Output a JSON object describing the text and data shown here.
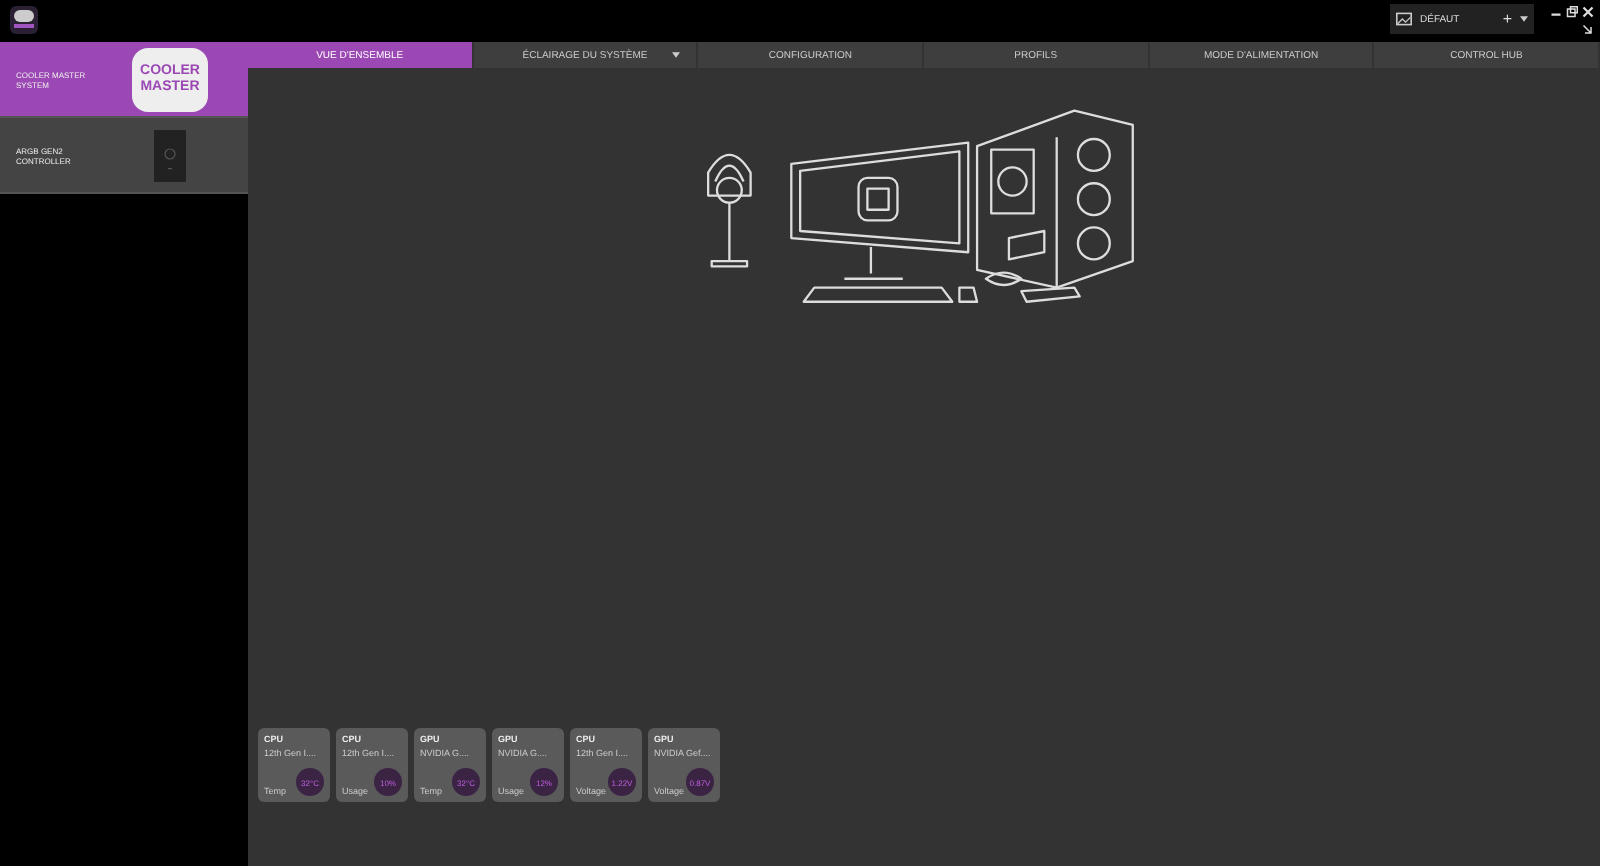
{
  "profile": {
    "name": "DÉFAUT",
    "add": "+"
  },
  "devices": [
    {
      "name": "COOLER MASTER SYSTEM",
      "selected": true,
      "kind": "logo",
      "logo_lines": [
        "COOLER",
        "MASTER"
      ]
    },
    {
      "name": "ARGB GEN2 CONTROLLER",
      "selected": false,
      "kind": "controller"
    }
  ],
  "tabs": [
    {
      "label": "VUE D'ENSEMBLE",
      "selected": true,
      "dropdown": false
    },
    {
      "label": "ÉCLAIRAGE DU SYSTÈME",
      "selected": false,
      "dropdown": true
    },
    {
      "label": "CONFIGURATION",
      "selected": false,
      "dropdown": false
    },
    {
      "label": "PROFILS",
      "selected": false,
      "dropdown": false
    },
    {
      "label": "MODE D'ALIMENTATION",
      "selected": false,
      "dropdown": false
    },
    {
      "label": "CONTROL HUB",
      "selected": false,
      "dropdown": false
    }
  ],
  "widgets": [
    {
      "title": "CPU",
      "device": "12th Gen I....",
      "metric": "Temp",
      "value": "32°C"
    },
    {
      "title": "CPU",
      "device": "12th Gen I....",
      "metric": "Usage",
      "value": "10%"
    },
    {
      "title": "GPU",
      "device": "NVIDIA G....",
      "metric": "Temp",
      "value": "32°C"
    },
    {
      "title": "GPU",
      "device": "NVIDIA G....",
      "metric": "Usage",
      "value": "12%"
    },
    {
      "title": "CPU",
      "device": "12th Gen I....",
      "metric": "Voltage",
      "value": "1.22V"
    },
    {
      "title": "GPU",
      "device": "NVIDIA Gef....",
      "metric": "Voltage",
      "value": "0.87V"
    }
  ]
}
